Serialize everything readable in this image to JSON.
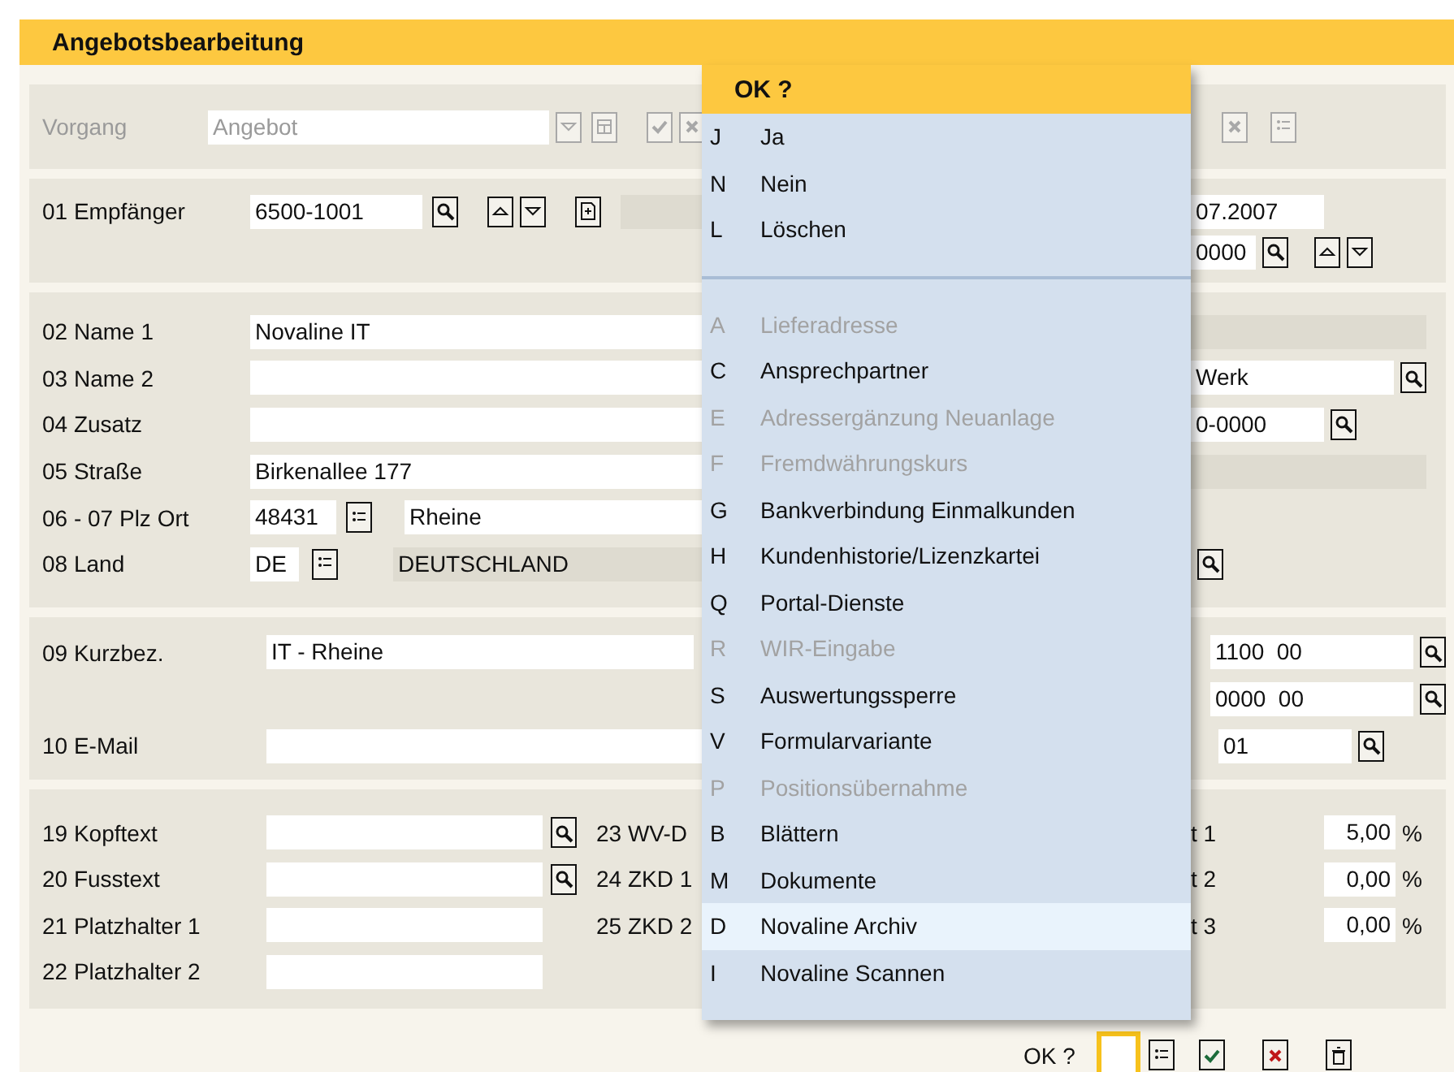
{
  "title": "Angebotsbearbeitung",
  "vorgang": {
    "label": "Vorgang",
    "value": "Angebot",
    "disabled": true
  },
  "empfaenger": {
    "label": "01 Empfänger",
    "value": "6500-1001",
    "right_values": [
      "07.2007",
      "0000"
    ]
  },
  "address": {
    "rows": [
      {
        "kind": "text",
        "label": "02 Name 1",
        "value": "Novaline IT",
        "right": {
          "kind": "readonly"
        }
      },
      {
        "kind": "text",
        "label": "03 Name 2",
        "right": {
          "kind": "lookup",
          "value": "Werk"
        }
      },
      {
        "kind": "text",
        "label": "04 Zusatz",
        "right": {
          "kind": "lookup_short",
          "value": "0-0000"
        }
      },
      {
        "kind": "text",
        "label": "05 Straße",
        "value": "Birkenallee 177",
        "right": {
          "kind": "readonly"
        }
      },
      {
        "kind": "plz",
        "label": "06 - 07 Plz Ort",
        "value": "48431",
        "value_2": "Rheine",
        "right": {
          "kind": "empty"
        }
      },
      {
        "kind": "land",
        "label": "08 Land",
        "value": "DE",
        "value_2": "DEUTSCHLAND",
        "right": {
          "kind": "search"
        }
      }
    ]
  },
  "contact": {
    "rows": [
      {
        "label": "09 Kurzbez.",
        "value": "IT - Rheine",
        "right": {
          "kind": "lookup",
          "value": "1100  00"
        }
      },
      {
        "right": {
          "kind": "lookup",
          "value": "0000  00"
        }
      },
      {
        "label": "10 E-Mail",
        "value": "",
        "right": {
          "kind": "lookup_short",
          "value": "01"
        }
      }
    ]
  },
  "texts": {
    "rows": [
      {
        "label": "19 Kopftext",
        "lookup": true,
        "middle": "23 WV-D",
        "right_label": "t 1",
        "right_value": "5,00",
        "unit": "%"
      },
      {
        "label": "20 Fusstext",
        "lookup": true,
        "middle": "24 ZKD 1",
        "right_label": "t 2",
        "right_value": "0,00",
        "unit": "%"
      },
      {
        "label": "21 Platzhalter 1",
        "lookup": false,
        "middle": "25 ZKD 2",
        "right_label": "t 3",
        "right_value": "0,00",
        "unit": "%"
      },
      {
        "label": "22 Platzhalter 2",
        "lookup": false
      }
    ]
  },
  "footer": {
    "label": "OK ?"
  },
  "popup": {
    "title": "OK ?",
    "groups": [
      [
        {
          "key": "J",
          "label": "Ja",
          "disabled": false,
          "selected": false
        },
        {
          "key": "N",
          "label": "Nein",
          "disabled": false,
          "selected": false
        },
        {
          "key": "L",
          "label": "Löschen",
          "disabled": false,
          "selected": false
        }
      ],
      [
        {
          "key": "A",
          "label": "Lieferadresse",
          "disabled": true,
          "selected": false
        },
        {
          "key": "C",
          "label": "Ansprechpartner",
          "disabled": false,
          "selected": false
        },
        {
          "key": "E",
          "label": "Adressergänzung Neuanlage",
          "disabled": true,
          "selected": false
        },
        {
          "key": "F",
          "label": "Fremdwährungskurs",
          "disabled": true,
          "selected": false
        },
        {
          "key": "G",
          "label": "Bankverbindung Einmalkunden",
          "disabled": false,
          "selected": false
        },
        {
          "key": "H",
          "label": "Kundenhistorie/Lizenzkartei",
          "disabled": false,
          "selected": false
        },
        {
          "key": "Q",
          "label": "Portal-Dienste",
          "disabled": false,
          "selected": false
        },
        {
          "key": "R",
          "label": "WIR-Eingabe",
          "disabled": true,
          "selected": false
        },
        {
          "key": "S",
          "label": "Auswertungssperre",
          "disabled": false,
          "selected": false
        },
        {
          "key": "V",
          "label": "Formularvariante",
          "disabled": false,
          "selected": false
        },
        {
          "key": "P",
          "label": "Positionsübernahme",
          "disabled": true,
          "selected": false
        },
        {
          "key": "B",
          "label": "Blättern",
          "disabled": false,
          "selected": false
        },
        {
          "key": "M",
          "label": "Dokumente",
          "disabled": false,
          "selected": false
        },
        {
          "key": "D",
          "label": "Novaline Archiv",
          "disabled": false,
          "selected": true
        },
        {
          "key": "I",
          "label": "Novaline Scannen",
          "disabled": false,
          "selected": false
        }
      ]
    ]
  }
}
